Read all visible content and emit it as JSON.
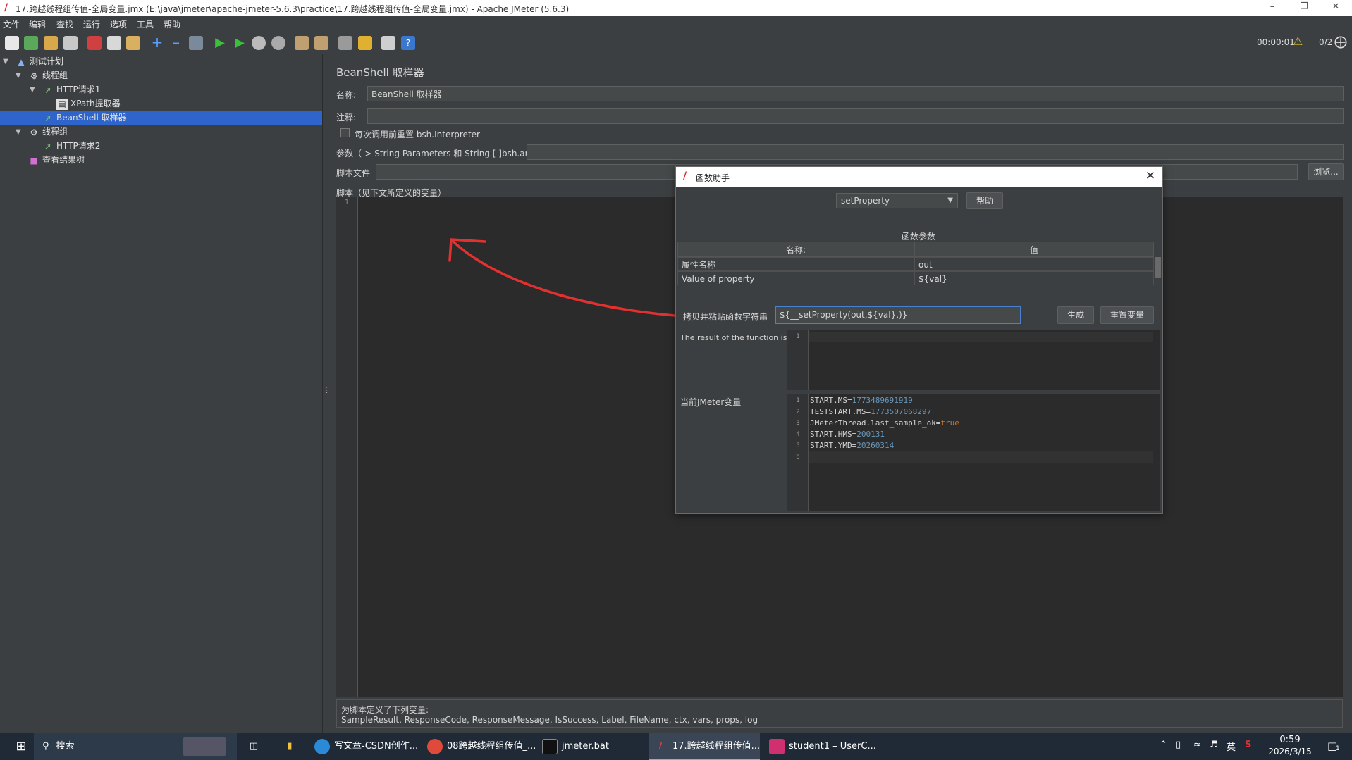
{
  "window": {
    "title": "17.跨越线程组传值-全局变量.jmx (E:\\java\\jmeter\\apache-jmeter-5.6.3\\practice\\17.跨越线程组传值-全局变量.jmx) - Apache JMeter (5.6.3)"
  },
  "menu": [
    "文件",
    "编辑",
    "查找",
    "运行",
    "选项",
    "工具",
    "帮助"
  ],
  "toolbar": {
    "timer": "00:00:01",
    "threads": "0/2"
  },
  "tree": {
    "items": [
      {
        "label": "测试计划"
      },
      {
        "label": "线程组"
      },
      {
        "label": "HTTP请求1"
      },
      {
        "label": "XPath提取器"
      },
      {
        "label": "BeanShell 取样器"
      },
      {
        "label": "线程组"
      },
      {
        "label": "HTTP请求2"
      },
      {
        "label": "查看结果树"
      }
    ]
  },
  "sampler": {
    "heading": "BeanShell 取样器",
    "name_label": "名称:",
    "name_value": "BeanShell 取样器",
    "comment_label": "注释:",
    "reset_label": "每次调用前重置 bsh.Interpreter",
    "params_label": "参数（-> String Parameters 和 String [ ]bsh.args)",
    "script_file_label": "脚本文件",
    "browse_label": "浏览...",
    "script_label": "脚本（见下文所定义的变量）",
    "gutter_line": "1",
    "vars_heading": "为脚本定义了下列变量:",
    "vars_list": "SampleResult, ResponseCode, ResponseMessage, IsSuccess, Label, FileName, ctx, vars, props, log"
  },
  "dialog": {
    "title": "函数助手",
    "function": "setProperty",
    "help_label": "帮助",
    "params_heading": "函数参数",
    "col_name": "名称:",
    "col_value": "值",
    "rows": [
      {
        "name": "属性名称",
        "value": "out"
      },
      {
        "name": "Value of property",
        "value": "${val}"
      }
    ],
    "copy_label": "拷贝并粘贴函数字符串",
    "function_string": "${__setProperty(out,${val},)}",
    "generate_label": "生成",
    "reset_vars_label": "重置变量",
    "result_label": "The result of the function is",
    "result_line": "1",
    "vars_label": "当前JMeter变量",
    "vars_lines": [
      {
        "n": "1",
        "key": "START.MS=",
        "val": "1773489691919"
      },
      {
        "n": "2",
        "key": "TESTSTART.MS=",
        "val": "1773507068297"
      },
      {
        "n": "3",
        "key": "JMeterThread.last_sample_ok=",
        "val": "true"
      },
      {
        "n": "4",
        "key": "START.HMS=",
        "val": "200131"
      },
      {
        "n": "5",
        "key": "START.YMD=",
        "val": "20260314"
      },
      {
        "n": "6",
        "key": "",
        "val": ""
      }
    ]
  },
  "taskbar": {
    "search": "搜索",
    "apps": [
      {
        "label": "写文章-CSDN创作..."
      },
      {
        "label": "08跨越线程组传值_..."
      },
      {
        "label": "jmeter.bat"
      },
      {
        "label": "17.跨越线程组传值..."
      },
      {
        "label": "student1 – UserC..."
      }
    ],
    "ime": "英",
    "time": "0:59",
    "date": "2026/3/15",
    "notif": "1"
  }
}
